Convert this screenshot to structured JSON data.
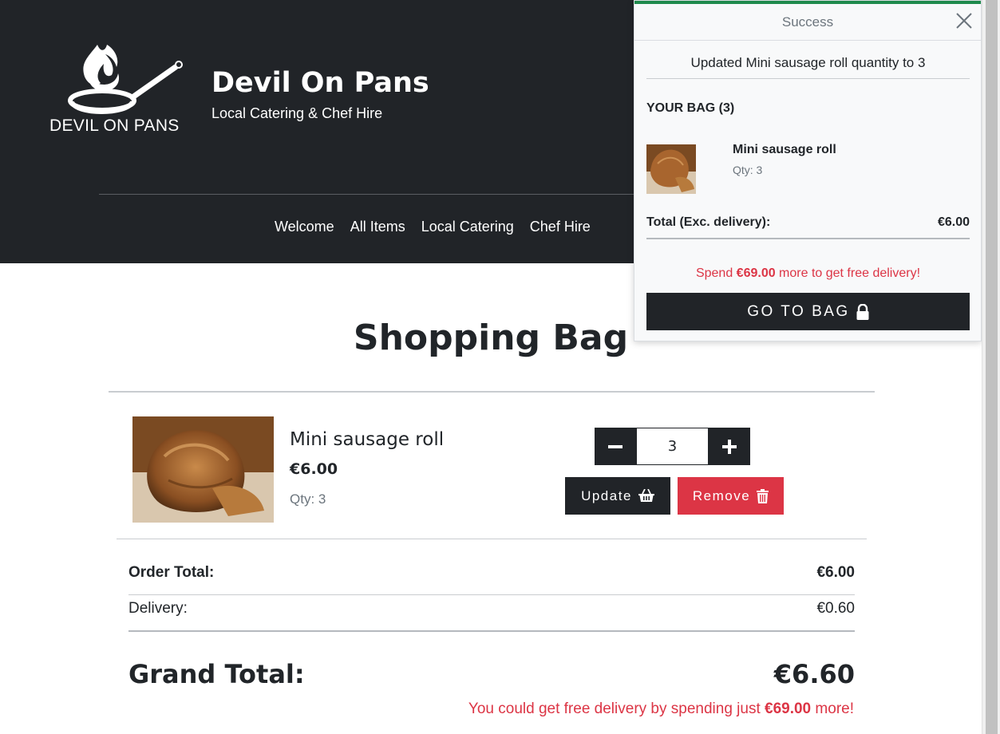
{
  "header": {
    "logo_text": "DEVIL ON PANS",
    "brand_title": "Devil On Pans",
    "brand_subtitle": "Local Catering & Chef Hire",
    "nav": [
      {
        "label": "Welcome"
      },
      {
        "label": "All Items"
      },
      {
        "label": "Local Catering"
      },
      {
        "label": "Chef Hire"
      }
    ]
  },
  "page": {
    "title": "Shopping Bag"
  },
  "bag_item": {
    "name": "Mini sausage roll",
    "price": "€6.00",
    "qty_label": "Qty: 3",
    "qty_value": "3",
    "update_label": "Update",
    "remove_label": "Remove"
  },
  "summary": {
    "order_total_label": "Order Total:",
    "order_total_value": "€6.00",
    "delivery_label": "Delivery:",
    "delivery_value": "€0.60",
    "grand_total_label": "Grand Total:",
    "grand_total_value": "€6.60",
    "free_note_prefix": "You could get free delivery by spending just ",
    "free_note_amount": "€69.00",
    "free_note_suffix": " more!"
  },
  "toast": {
    "title": "Success",
    "message": "Updated Mini sausage roll quantity to 3",
    "bag_heading": "YOUR BAG (3)",
    "item_name": "Mini sausage roll",
    "item_qty": "Qty: 3",
    "total_label": "Total (Exc. delivery):",
    "total_value": "€6.00",
    "spend_prefix": "Spend ",
    "spend_amount": "€69.00",
    "spend_suffix": " more to get free delivery!",
    "button_label": "GO TO BAG"
  },
  "colors": {
    "header_bg": "#212428",
    "danger": "#dc3545",
    "success_bar": "#1e8a4c"
  },
  "icons": [
    "minus-icon",
    "plus-icon",
    "basket-icon",
    "trash-icon",
    "lock-icon",
    "close-icon",
    "pan-logo-icon"
  ]
}
